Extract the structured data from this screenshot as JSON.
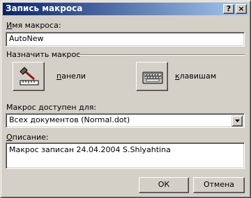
{
  "window": {
    "title": "Запись макроса",
    "help_button": "?",
    "close_button": "×"
  },
  "macro_name": {
    "label_accel": "И",
    "label_rest": "мя макроса:",
    "value": "AutoNew"
  },
  "assign": {
    "group_label": "Назначить макрос",
    "toolbar_label_accel": "п",
    "toolbar_label_rest": "анели",
    "toolbar_icon": "hammer-ruler-icon",
    "keyboard_label_accel": "к",
    "keyboard_label_rest": "лавишам",
    "keyboard_icon": "keyboard-icon"
  },
  "store_in": {
    "label_pre": "Макрос ",
    "label_accel": "д",
    "label_rest": "оступен для:",
    "selected": "Всех документов (Normal.dot)"
  },
  "description": {
    "label_accel": "О",
    "label_rest": "писание:",
    "value": "Макрос записан 24.04.2004 S.Shlyahtina"
  },
  "buttons": {
    "ok": "ОК",
    "cancel": "Отмена"
  }
}
